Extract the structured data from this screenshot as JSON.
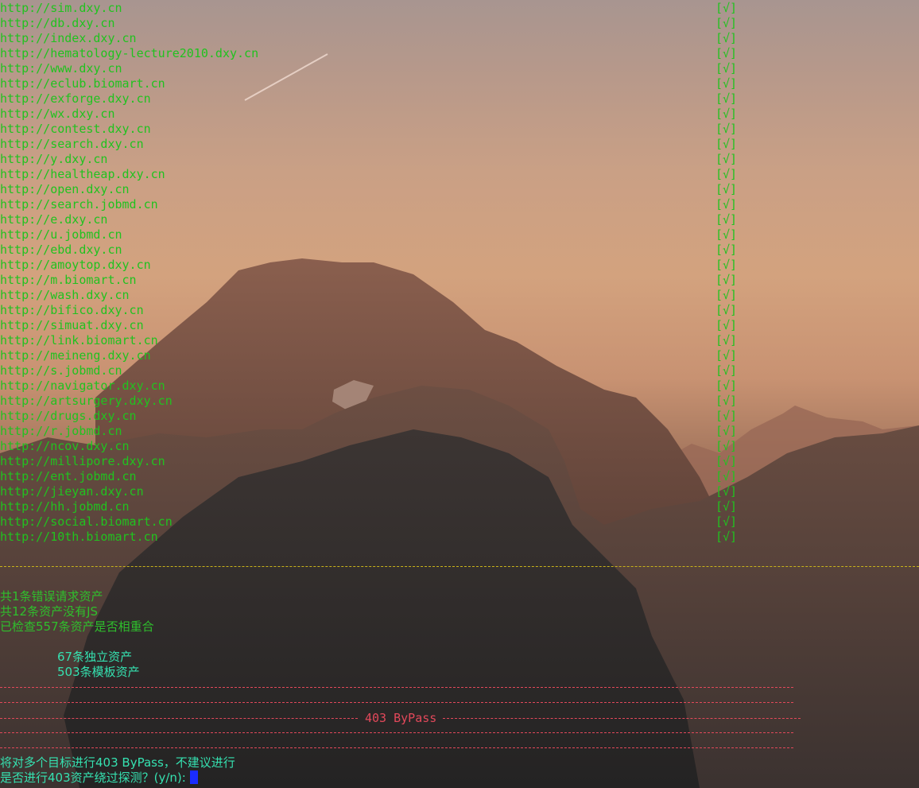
{
  "terminal": {
    "urls": [
      {
        "url": "http://sim.dxy.cn",
        "status": "[√]"
      },
      {
        "url": "http://db.dxy.cn",
        "status": "[√]"
      },
      {
        "url": "http://index.dxy.cn",
        "status": "[√]"
      },
      {
        "url": "http://hematology-lecture2010.dxy.cn",
        "status": "[√]"
      },
      {
        "url": "http://www.dxy.cn",
        "status": "[√]"
      },
      {
        "url": "http://eclub.biomart.cn",
        "status": "[√]"
      },
      {
        "url": "http://exforge.dxy.cn",
        "status": "[√]"
      },
      {
        "url": "http://wx.dxy.cn",
        "status": "[√]"
      },
      {
        "url": "http://contest.dxy.cn",
        "status": "[√]"
      },
      {
        "url": "http://search.dxy.cn",
        "status": "[√]"
      },
      {
        "url": "http://y.dxy.cn",
        "status": "[√]"
      },
      {
        "url": "http://healtheap.dxy.cn",
        "status": "[√]"
      },
      {
        "url": "http://open.dxy.cn",
        "status": "[√]"
      },
      {
        "url": "http://search.jobmd.cn",
        "status": "[√]"
      },
      {
        "url": "http://e.dxy.cn",
        "status": "[√]"
      },
      {
        "url": "http://u.jobmd.cn",
        "status": "[√]"
      },
      {
        "url": "http://ebd.dxy.cn",
        "status": "[√]"
      },
      {
        "url": "http://amoytop.dxy.cn",
        "status": "[√]"
      },
      {
        "url": "http://m.biomart.cn",
        "status": "[√]"
      },
      {
        "url": "http://wash.dxy.cn",
        "status": "[√]"
      },
      {
        "url": "http://bifico.dxy.cn",
        "status": "[√]"
      },
      {
        "url": "http://simuat.dxy.cn",
        "status": "[√]"
      },
      {
        "url": "http://link.biomart.cn",
        "status": "[√]"
      },
      {
        "url": "http://meineng.dxy.cn",
        "status": "[√]"
      },
      {
        "url": "http://s.jobmd.cn",
        "status": "[√]"
      },
      {
        "url": "http://navigator.dxy.cn",
        "status": "[√]"
      },
      {
        "url": "http://artsurgery.dxy.cn",
        "status": "[√]"
      },
      {
        "url": "http://drugs.dxy.cn",
        "status": "[√]"
      },
      {
        "url": "http://r.jobmd.cn",
        "status": "[√]"
      },
      {
        "url": "http://ncov.dxy.cn",
        "status": "[√]"
      },
      {
        "url": "http://millipore.dxy.cn",
        "status": "[√]"
      },
      {
        "url": "http://ent.jobmd.cn",
        "status": "[√]"
      },
      {
        "url": "http://jieyan.dxy.cn",
        "status": "[√]"
      },
      {
        "url": "http://hh.jobmd.cn",
        "status": "[√]"
      },
      {
        "url": "http://social.biomart.cn",
        "status": "[√]"
      },
      {
        "url": "http://10th.biomart.cn",
        "status": "[√]"
      }
    ],
    "summary": {
      "error_requests": "共1条错误请求资产",
      "no_js": "共12条资产没有JS",
      "checked": "已检查557条资产是否相重合",
      "unique": "67条独立资产",
      "template": "503条模板资产"
    },
    "bypass": {
      "title": "403 ByPass",
      "warning": "将对多个目标进行403 ByPass，不建议进行",
      "prompt": "是否进行403资产绕过探测？(y/n): "
    }
  },
  "colors": {
    "url_green": "#21c21f",
    "summary_green": "#2fbf2c",
    "cyan": "#35e1b0",
    "red": "#e2485a",
    "yellow": "#c9b31a",
    "cursor": "#1a2cff"
  }
}
